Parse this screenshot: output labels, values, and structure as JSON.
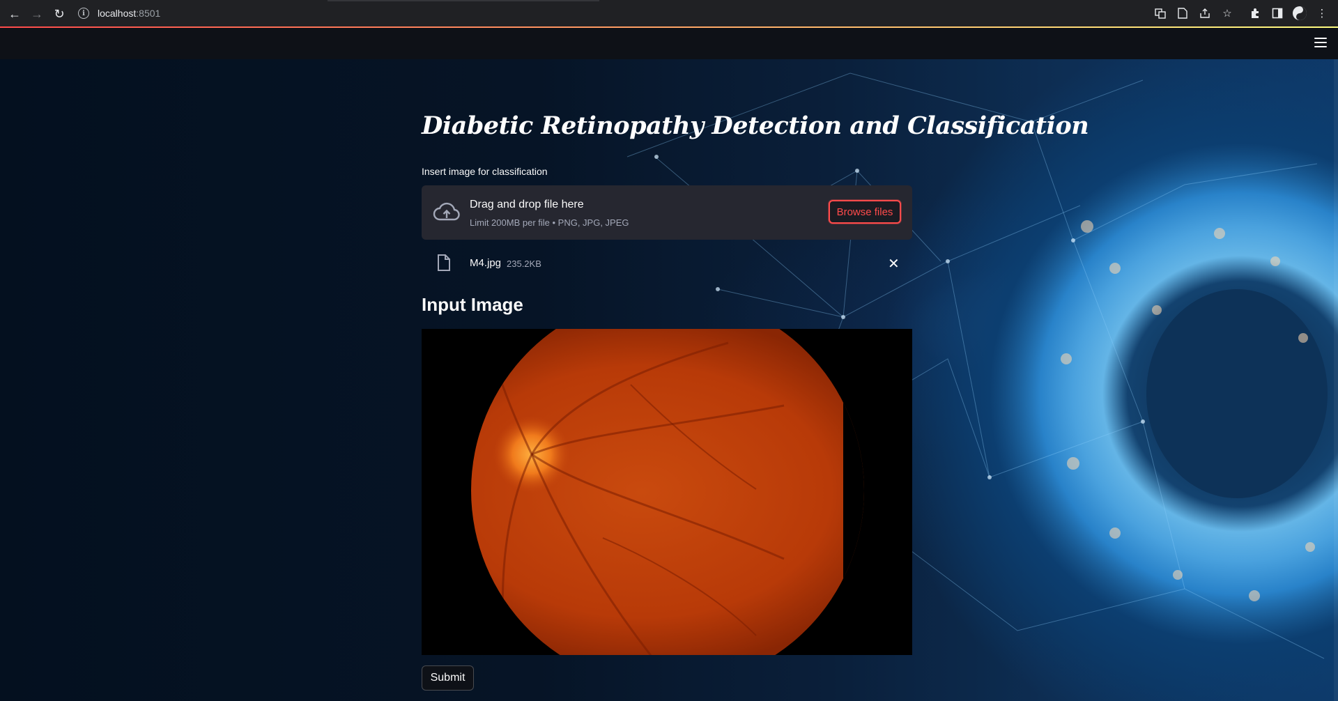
{
  "browser": {
    "url_host": "localhost",
    "url_port": ":8501",
    "icons": [
      "back-arrow-icon",
      "forward-arrow-icon",
      "reload-icon",
      "info-icon",
      "translate-icon",
      "page-icon",
      "share-icon",
      "star-icon",
      "extensions-icon",
      "side-panel-icon",
      "profile-icon",
      "menu-dots-icon"
    ]
  },
  "app": {
    "title": "Diabetic Retinopathy Detection and Classification",
    "uploader": {
      "label": "Insert image for classification",
      "drag_text": "Drag and drop file here",
      "limit_text": "Limit 200MB per file • PNG, JPG, JPEG",
      "browse_label": "Browse files"
    },
    "uploaded_file": {
      "name": "M4.jpg",
      "size": "235.2KB"
    },
    "subheader": "Input Image",
    "submit_label": "Submit"
  },
  "colors": {
    "accent": "#ff4b4b",
    "background": "#0e1117",
    "dropzone": "#262730",
    "fundus_orange": "#c8400a"
  }
}
